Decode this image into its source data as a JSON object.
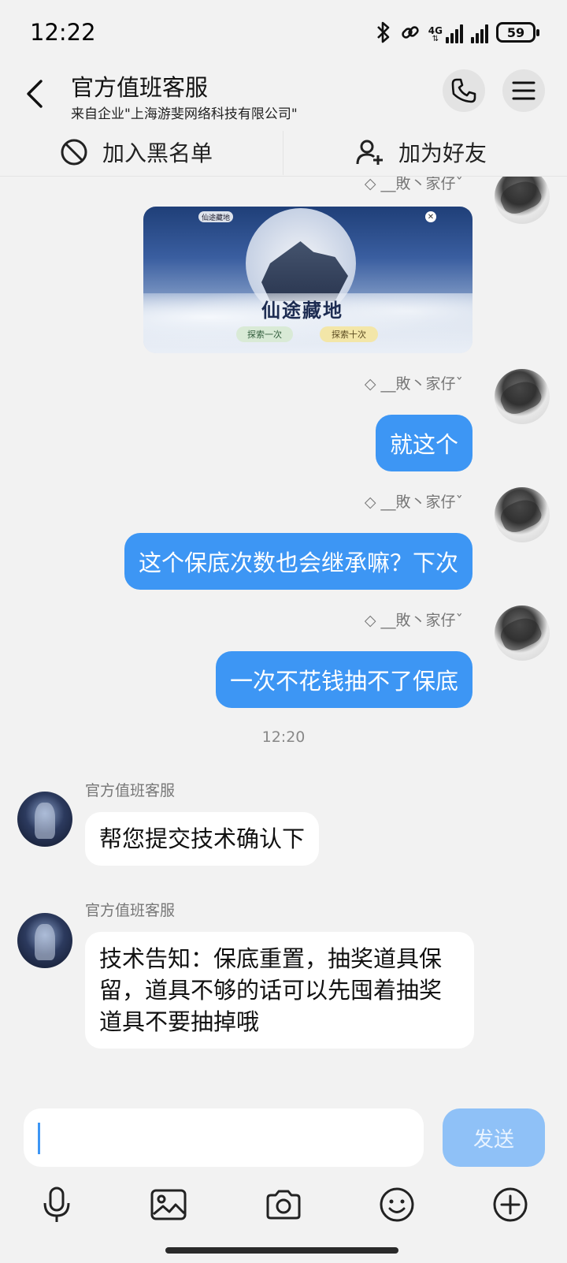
{
  "status": {
    "time": "12:22",
    "network": "4G",
    "battery": "59"
  },
  "header": {
    "title": "官方值班客服",
    "subtitle": "来自企业\"上海游斐网络科技有限公司\""
  },
  "actions": {
    "blacklist": "加入黑名单",
    "add_friend": "加为好友"
  },
  "chat": {
    "me_name": "◇ __敗丶家仔ˇ",
    "cs_name": "官方值班客服",
    "image_card": {
      "title": "仙途藏地",
      "badge": "仙途藏地",
      "btn_one": "探索一次",
      "btn_ten": "探索十次"
    },
    "messages_out": [
      "就这个",
      "这个保底次数也会继承嘛？下次",
      "一次不花钱抽不了保底"
    ],
    "time_divider": "12:20",
    "messages_in": [
      "帮您提交技术确认下",
      "技术告知：保底重置，抽奖道具保留，道具不够的话可以先囤着抽奖道具不要抽掉哦"
    ]
  },
  "composer": {
    "input_value": "",
    "send_label": "发送"
  },
  "colors": {
    "bubble_out": "#3d96f4",
    "send_disabled": "#8fc1f7",
    "background": "#f2f2f2"
  }
}
